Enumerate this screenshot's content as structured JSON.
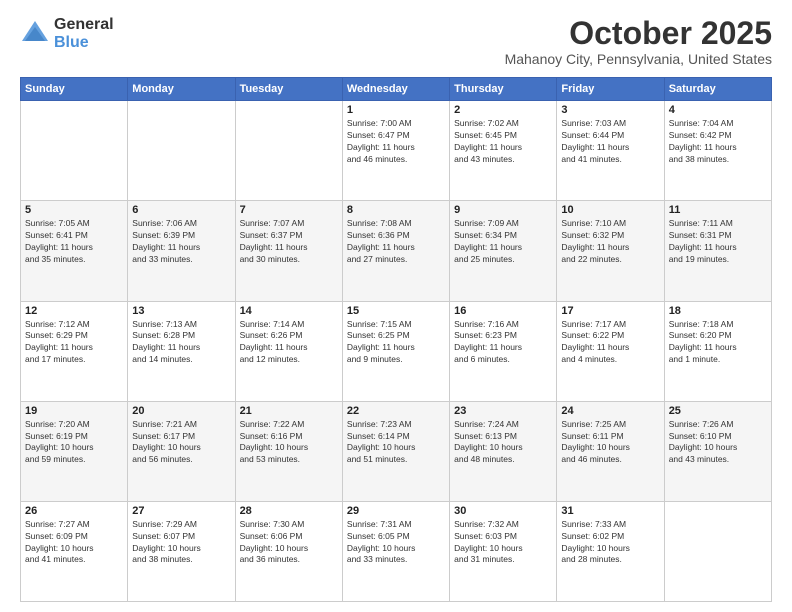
{
  "header": {
    "logo": {
      "general": "General",
      "blue": "Blue"
    },
    "month": "October 2025",
    "location": "Mahanoy City, Pennsylvania, United States"
  },
  "days_of_week": [
    "Sunday",
    "Monday",
    "Tuesday",
    "Wednesday",
    "Thursday",
    "Friday",
    "Saturday"
  ],
  "weeks": [
    [
      {
        "day": "",
        "info": ""
      },
      {
        "day": "",
        "info": ""
      },
      {
        "day": "",
        "info": ""
      },
      {
        "day": "1",
        "info": "Sunrise: 7:00 AM\nSunset: 6:47 PM\nDaylight: 11 hours\nand 46 minutes."
      },
      {
        "day": "2",
        "info": "Sunrise: 7:02 AM\nSunset: 6:45 PM\nDaylight: 11 hours\nand 43 minutes."
      },
      {
        "day": "3",
        "info": "Sunrise: 7:03 AM\nSunset: 6:44 PM\nDaylight: 11 hours\nand 41 minutes."
      },
      {
        "day": "4",
        "info": "Sunrise: 7:04 AM\nSunset: 6:42 PM\nDaylight: 11 hours\nand 38 minutes."
      }
    ],
    [
      {
        "day": "5",
        "info": "Sunrise: 7:05 AM\nSunset: 6:41 PM\nDaylight: 11 hours\nand 35 minutes."
      },
      {
        "day": "6",
        "info": "Sunrise: 7:06 AM\nSunset: 6:39 PM\nDaylight: 11 hours\nand 33 minutes."
      },
      {
        "day": "7",
        "info": "Sunrise: 7:07 AM\nSunset: 6:37 PM\nDaylight: 11 hours\nand 30 minutes."
      },
      {
        "day": "8",
        "info": "Sunrise: 7:08 AM\nSunset: 6:36 PM\nDaylight: 11 hours\nand 27 minutes."
      },
      {
        "day": "9",
        "info": "Sunrise: 7:09 AM\nSunset: 6:34 PM\nDaylight: 11 hours\nand 25 minutes."
      },
      {
        "day": "10",
        "info": "Sunrise: 7:10 AM\nSunset: 6:32 PM\nDaylight: 11 hours\nand 22 minutes."
      },
      {
        "day": "11",
        "info": "Sunrise: 7:11 AM\nSunset: 6:31 PM\nDaylight: 11 hours\nand 19 minutes."
      }
    ],
    [
      {
        "day": "12",
        "info": "Sunrise: 7:12 AM\nSunset: 6:29 PM\nDaylight: 11 hours\nand 17 minutes."
      },
      {
        "day": "13",
        "info": "Sunrise: 7:13 AM\nSunset: 6:28 PM\nDaylight: 11 hours\nand 14 minutes."
      },
      {
        "day": "14",
        "info": "Sunrise: 7:14 AM\nSunset: 6:26 PM\nDaylight: 11 hours\nand 12 minutes."
      },
      {
        "day": "15",
        "info": "Sunrise: 7:15 AM\nSunset: 6:25 PM\nDaylight: 11 hours\nand 9 minutes."
      },
      {
        "day": "16",
        "info": "Sunrise: 7:16 AM\nSunset: 6:23 PM\nDaylight: 11 hours\nand 6 minutes."
      },
      {
        "day": "17",
        "info": "Sunrise: 7:17 AM\nSunset: 6:22 PM\nDaylight: 11 hours\nand 4 minutes."
      },
      {
        "day": "18",
        "info": "Sunrise: 7:18 AM\nSunset: 6:20 PM\nDaylight: 11 hours\nand 1 minute."
      }
    ],
    [
      {
        "day": "19",
        "info": "Sunrise: 7:20 AM\nSunset: 6:19 PM\nDaylight: 10 hours\nand 59 minutes."
      },
      {
        "day": "20",
        "info": "Sunrise: 7:21 AM\nSunset: 6:17 PM\nDaylight: 10 hours\nand 56 minutes."
      },
      {
        "day": "21",
        "info": "Sunrise: 7:22 AM\nSunset: 6:16 PM\nDaylight: 10 hours\nand 53 minutes."
      },
      {
        "day": "22",
        "info": "Sunrise: 7:23 AM\nSunset: 6:14 PM\nDaylight: 10 hours\nand 51 minutes."
      },
      {
        "day": "23",
        "info": "Sunrise: 7:24 AM\nSunset: 6:13 PM\nDaylight: 10 hours\nand 48 minutes."
      },
      {
        "day": "24",
        "info": "Sunrise: 7:25 AM\nSunset: 6:11 PM\nDaylight: 10 hours\nand 46 minutes."
      },
      {
        "day": "25",
        "info": "Sunrise: 7:26 AM\nSunset: 6:10 PM\nDaylight: 10 hours\nand 43 minutes."
      }
    ],
    [
      {
        "day": "26",
        "info": "Sunrise: 7:27 AM\nSunset: 6:09 PM\nDaylight: 10 hours\nand 41 minutes."
      },
      {
        "day": "27",
        "info": "Sunrise: 7:29 AM\nSunset: 6:07 PM\nDaylight: 10 hours\nand 38 minutes."
      },
      {
        "day": "28",
        "info": "Sunrise: 7:30 AM\nSunset: 6:06 PM\nDaylight: 10 hours\nand 36 minutes."
      },
      {
        "day": "29",
        "info": "Sunrise: 7:31 AM\nSunset: 6:05 PM\nDaylight: 10 hours\nand 33 minutes."
      },
      {
        "day": "30",
        "info": "Sunrise: 7:32 AM\nSunset: 6:03 PM\nDaylight: 10 hours\nand 31 minutes."
      },
      {
        "day": "31",
        "info": "Sunrise: 7:33 AM\nSunset: 6:02 PM\nDaylight: 10 hours\nand 28 minutes."
      },
      {
        "day": "",
        "info": ""
      }
    ]
  ]
}
